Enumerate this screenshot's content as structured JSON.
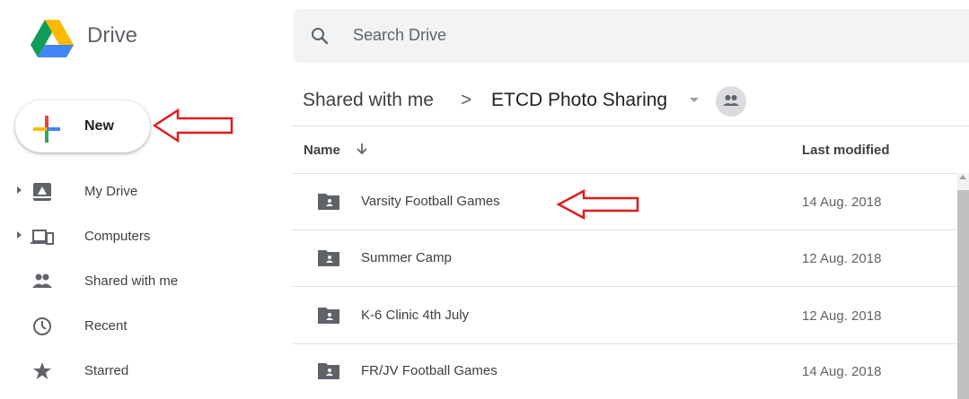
{
  "header": {
    "app_title": "Drive",
    "search": {
      "placeholder": "Search Drive"
    }
  },
  "new_button": {
    "label": "New"
  },
  "sidebar": {
    "items": [
      {
        "label": "My Drive",
        "icon": "my-drive-icon",
        "expandable": true
      },
      {
        "label": "Computers",
        "icon": "computers-icon",
        "expandable": true
      },
      {
        "label": "Shared with me",
        "icon": "people-icon",
        "expandable": false
      },
      {
        "label": "Recent",
        "icon": "clock-icon",
        "expandable": false
      },
      {
        "label": "Starred",
        "icon": "star-icon",
        "expandable": false
      }
    ]
  },
  "breadcrumb": {
    "root": "Shared with me",
    "separator": ">",
    "current": "ETCD Photo Sharing"
  },
  "file_list": {
    "columns": {
      "name": "Name",
      "modified": "Last modified"
    },
    "rows": [
      {
        "name": "Varsity Football Games",
        "modified": "14 Aug. 2018",
        "icon": "shared-folder-icon"
      },
      {
        "name": "Summer Camp",
        "modified": "12 Aug. 2018",
        "icon": "shared-folder-icon"
      },
      {
        "name": "K-6 Clinic 4th July",
        "modified": "12 Aug. 2018",
        "icon": "shared-folder-icon"
      },
      {
        "name": "FR/JV Football Games",
        "modified": "14 Aug. 2018",
        "icon": "shared-folder-icon"
      }
    ]
  },
  "colors": {
    "annotation_arrow": "#e01b1b",
    "search_bg": "#f1f3f4",
    "icon_gray": "#5f6368"
  }
}
